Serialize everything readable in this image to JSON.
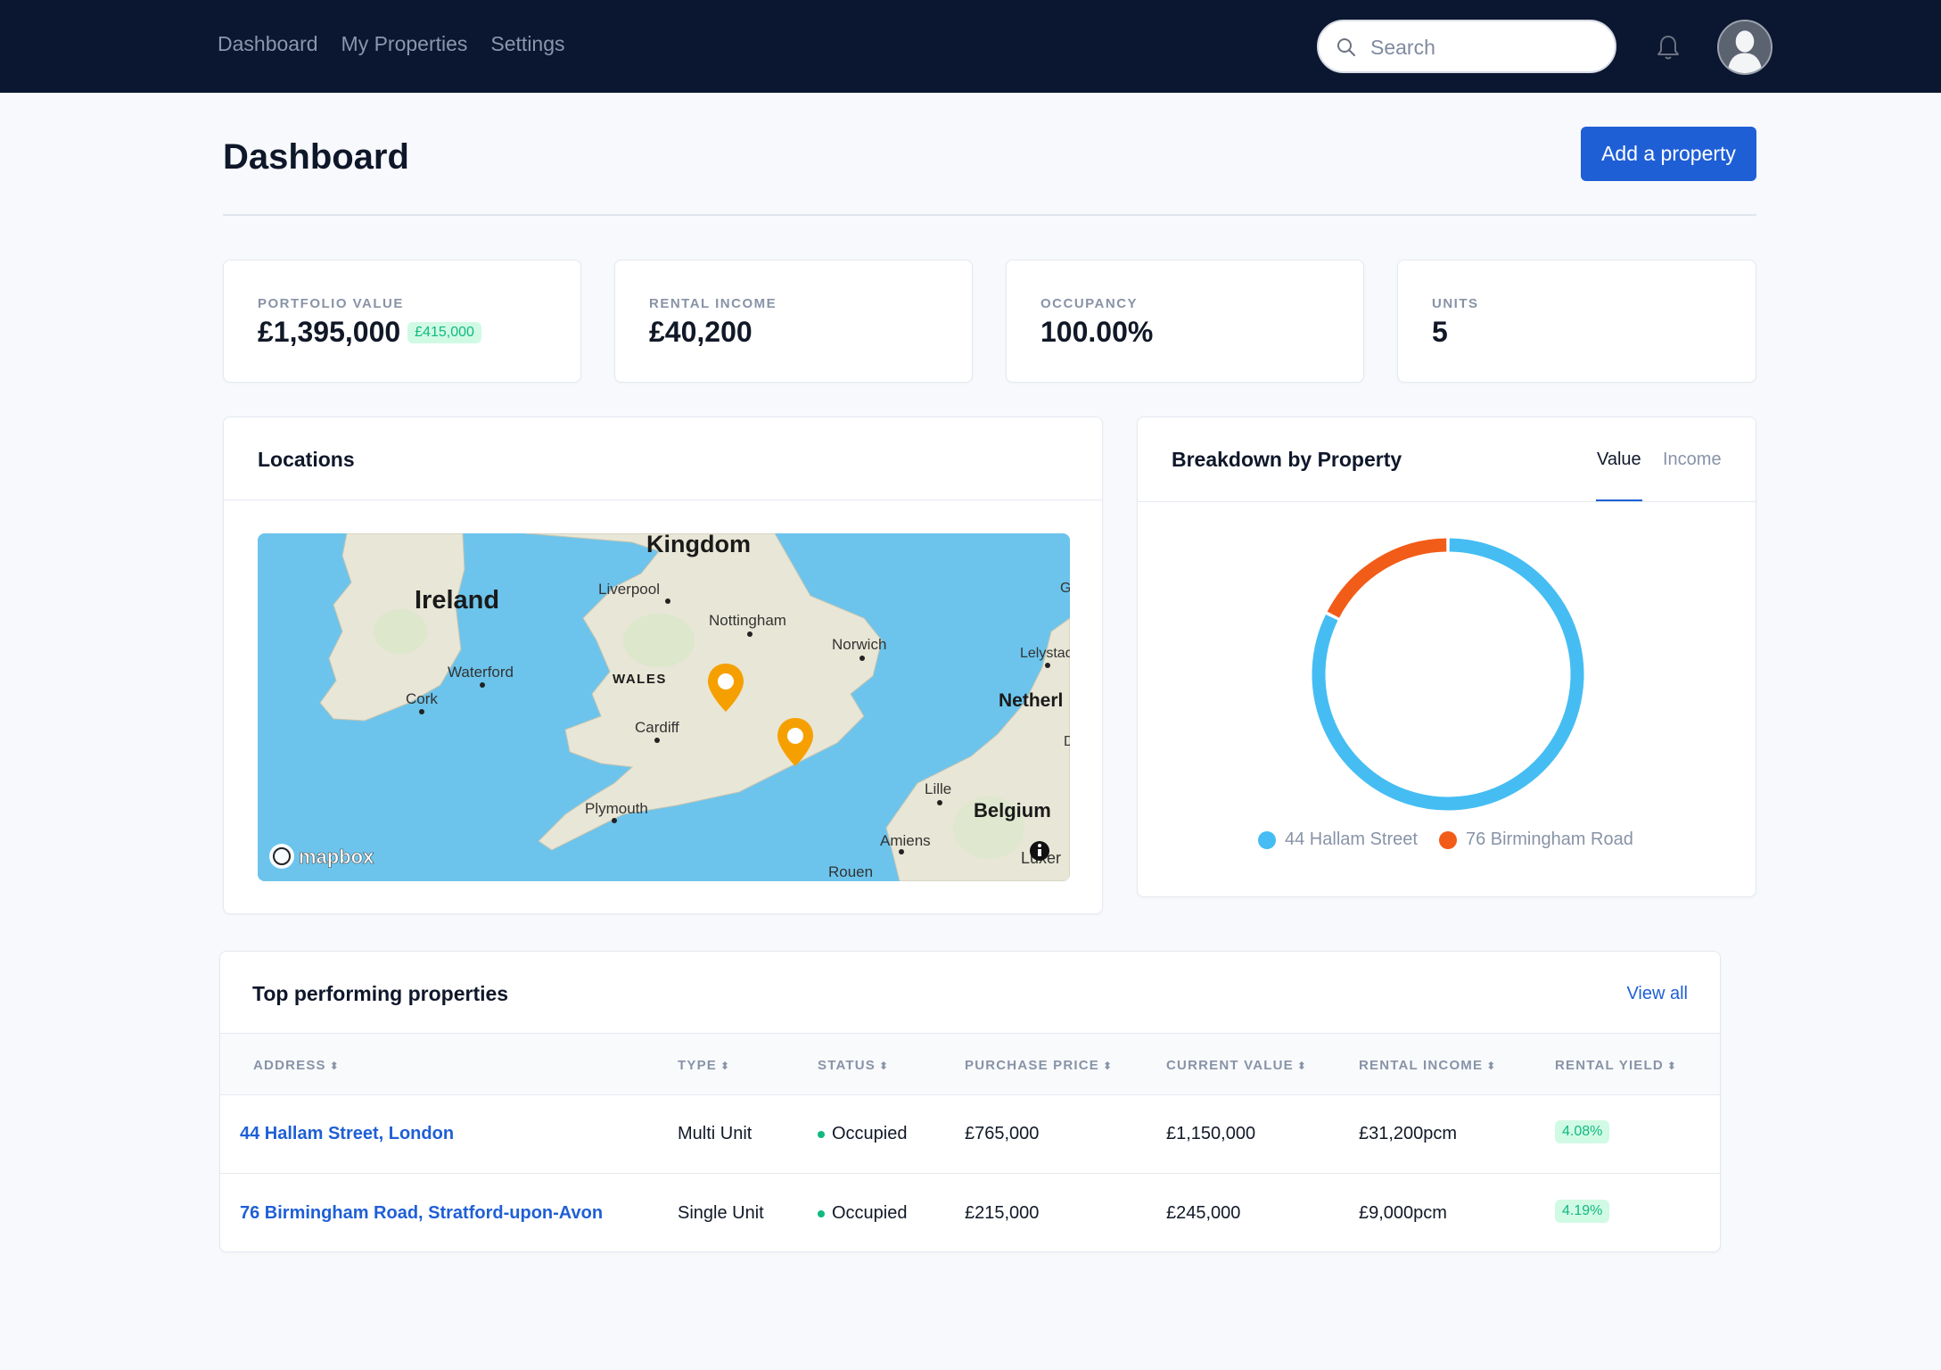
{
  "nav": {
    "links": [
      "Dashboard",
      "My Properties",
      "Settings"
    ],
    "search_placeholder": "Search"
  },
  "header": {
    "title": "Dashboard",
    "add_button": "Add a property"
  },
  "stats": [
    {
      "label": "PORTFOLIO VALUE",
      "value": "£1,395,000",
      "badge": "£415,000"
    },
    {
      "label": "RENTAL INCOME",
      "value": "£40,200"
    },
    {
      "label": "OCCUPANCY",
      "value": "100.00%"
    },
    {
      "label": "UNITS",
      "value": "5"
    }
  ],
  "locations": {
    "title": "Locations",
    "map_labels": {
      "kingdom": "Kingdom",
      "ireland": "Ireland",
      "liverpool": "Liverpool",
      "nottingham": "Nottingham",
      "norwich": "Norwich",
      "wales": "WALES",
      "waterford": "Waterford",
      "cork": "Cork",
      "cardiff": "Cardiff",
      "plymouth": "Plymouth",
      "lelystad": "Lelystad",
      "netherlands": "Netherl",
      "lille": "Lille",
      "belgium": "Belgium",
      "amiens": "Amiens",
      "rouen": "Rouen",
      "luxembourg": "Luxer",
      "edge_g": "G",
      "edge_d": "D"
    },
    "attribution": "mapbox"
  },
  "breakdown": {
    "title": "Breakdown by Property",
    "tabs": [
      "Value",
      "Income"
    ],
    "active_tab": "Value",
    "colors": [
      "#45bdf3",
      "#f25c19"
    ],
    "legend": [
      "44 Hallam Street",
      "76 Birmingham Road"
    ],
    "values": [
      1150000,
      245000
    ]
  },
  "table": {
    "title": "Top performing properties",
    "view_all": "View all",
    "columns": [
      "ADDRESS",
      "TYPE",
      "STATUS",
      "PURCHASE PRICE",
      "CURRENT VALUE",
      "RENTAL INCOME",
      "RENTAL YIELD"
    ],
    "rows": [
      {
        "address": "44 Hallam Street, London",
        "type": "Multi Unit",
        "status": "Occupied",
        "purchase": "£765,000",
        "current": "£1,150,000",
        "income": "£31,200pcm",
        "yield": "4.08%"
      },
      {
        "address": "76 Birmingham Road, Stratford-upon-Avon",
        "type": "Single Unit",
        "status": "Occupied",
        "purchase": "£215,000",
        "current": "£245,000",
        "income": "£9,000pcm",
        "yield": "4.19%"
      }
    ]
  }
}
